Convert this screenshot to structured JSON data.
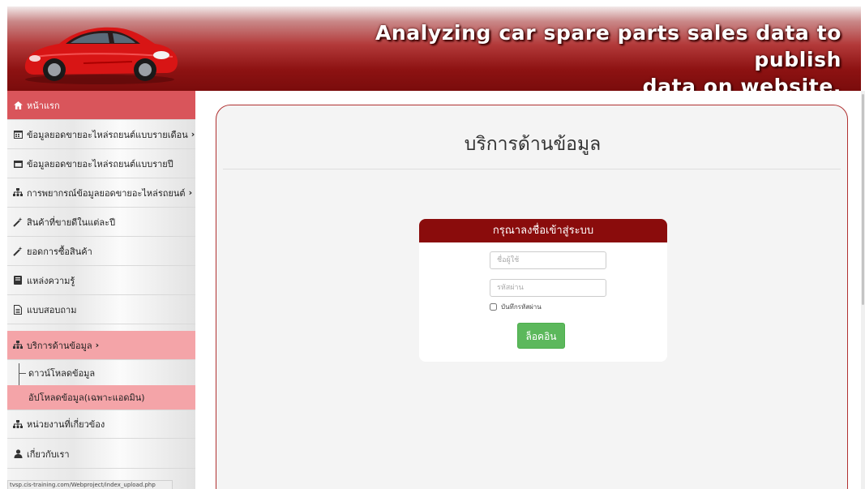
{
  "header": {
    "title_line1": "Analyzing car spare parts sales data to publish",
    "title_line2": "data on website.",
    "car_image": "red-sports-car"
  },
  "sidebar": {
    "items": [
      {
        "label": "หน้าแรก",
        "icon": "home-icon",
        "caret": ""
      },
      {
        "label": "ข้อมูลยอดขายอะไหล่รถยนต์แบบรายเดือน",
        "icon": "calendar-icon",
        "caret": "›"
      },
      {
        "label": "ข้อมูลยอดขายอะไหล่รถยนต์แบบรายปี",
        "icon": "calendar-icon",
        "caret": ""
      },
      {
        "label": "การพยากรณ์ข้อมูลยอดขายอะไหล่รถยนต์",
        "icon": "network-icon",
        "caret": "›"
      },
      {
        "label": "สินค้าที่ขายดีในแต่ละปี",
        "icon": "magic-wand-icon",
        "caret": ""
      },
      {
        "label": "ยอดการซื้อสินค้า",
        "icon": "magic-wand-icon",
        "caret": ""
      },
      {
        "label": "แหล่งความรู้",
        "icon": "book-icon",
        "caret": ""
      },
      {
        "label": "แบบสอบถาม",
        "icon": "document-icon",
        "caret": ""
      },
      {
        "label": "บริการด้านข้อมูล",
        "icon": "sitemap-icon",
        "caret": "›"
      },
      {
        "label": "หน่วยงานที่เกี่ยวข้อง",
        "icon": "sitemap-icon",
        "caret": ""
      },
      {
        "label": "เกี่ยวกับเรา",
        "icon": "user-icon",
        "caret": ""
      }
    ],
    "sub_items": [
      {
        "label": "ดาวน์โหลดข้อมูล"
      },
      {
        "label": "อัปโหลดข้อมูล(เฉพาะแอดมิน)"
      }
    ],
    "status_url": "tvsp.cis-training.com/Webproject/index_upload.php"
  },
  "main": {
    "title": "บริการด้านข้อมูล"
  },
  "login": {
    "header": "กรุณาลงชื่อเข้าสู่ระบบ",
    "username_placeholder": "ชื่อผู้ใช้",
    "password_placeholder": "รหัสผ่าน",
    "remember_label": "บันทึกรหัสผ่าน",
    "button_label": "ล็อคอิน"
  },
  "colors": {
    "banner_dark": "#7a0c0c",
    "sidebar_active": "#d9555b",
    "sidebar_highlight": "#f4a4a8",
    "login_header": "#8a0c0c",
    "login_button": "#5cb85c",
    "panel_border": "#b03030"
  }
}
